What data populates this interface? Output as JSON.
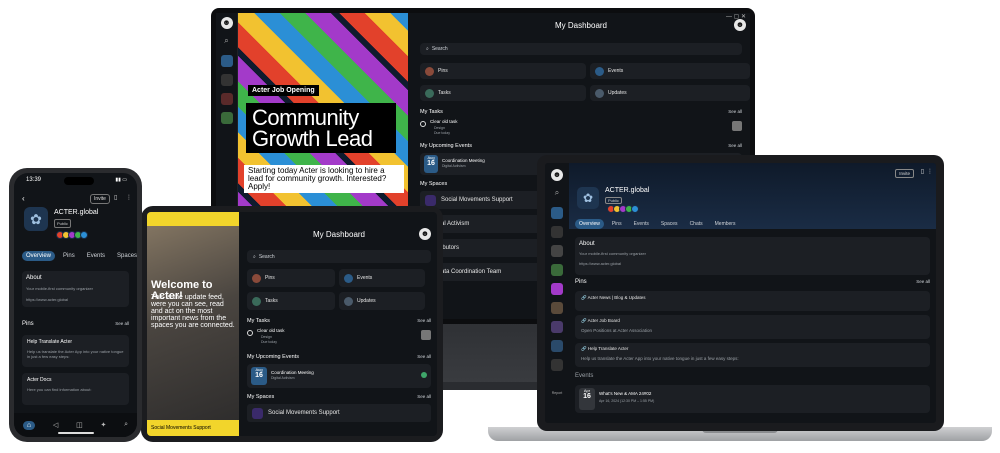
{
  "monitor": {
    "title": "My Dashboard",
    "poster": {
      "label": "Acter Job Opening",
      "title": "Community Growth Lead",
      "subtitle": "Starting today Acter is looking to hire a lead for community growth. Interested? Apply!"
    },
    "search_placeholder": "Search",
    "tiles": [
      "Pins",
      "Events",
      "Tasks",
      "Updates"
    ],
    "my_tasks": {
      "heading": "My Tasks",
      "see_all": "See all",
      "task": "Clear old task",
      "meta1": "Design",
      "meta2": "Due today"
    },
    "my_events": {
      "heading": "My Upcoming Events",
      "see_all": "See all",
      "month": "Aug",
      "day": "16",
      "title": "Coordination Meeting",
      "sub": "Digital Activism"
    },
    "my_spaces": {
      "heading": "My Spaces",
      "items": [
        "Social Movements Support",
        "al Activism",
        "ibutors",
        "ata Coordination Team"
      ]
    }
  },
  "tablet": {
    "title": "My Dashboard",
    "welcome": "Welcome to Acter!",
    "welcome_body": "This is the update feed, were you can see, read and act on the most important news from the spaces you are connected.",
    "footer": "Social Movements Support",
    "search_placeholder": "Search",
    "tiles": [
      "Pins",
      "Events",
      "Tasks",
      "Updates"
    ],
    "my_tasks": {
      "heading": "My Tasks",
      "see_all": "See all",
      "task": "Clear old task",
      "meta1": "Design",
      "meta2": "Due today"
    },
    "my_events": {
      "heading": "My Upcoming Events",
      "see_all": "See all",
      "month": "Aug",
      "day": "16",
      "title": "Coordination Meeting",
      "sub": "Digital Activism"
    },
    "my_spaces": {
      "heading": "My Spaces",
      "see_all": "See all",
      "item": "Social Movements Support"
    }
  },
  "phone": {
    "time": "13:39",
    "invite": "Invite",
    "space_name": "ACTER.global",
    "visibility": "Public",
    "tabs": [
      "Overview",
      "Pins",
      "Events",
      "Spaces"
    ],
    "about_title": "About",
    "about_text": "Your mobile-first community organizer",
    "about_url": "https://www.acter.global",
    "pins_heading": "Pins",
    "see_all": "See all",
    "pin1_title": "Help Translate Acter",
    "pin1_text": "Help us translate the Acter App into your native tongue in just a few easy steps:",
    "pin2_title": "Acter Docs",
    "pin2_text": "Here you can find information about:"
  },
  "laptop": {
    "invite": "Invite",
    "space_name": "ACTER.global",
    "visibility": "Public",
    "tabs": [
      "Overview",
      "Pins",
      "Events",
      "Spaces",
      "Chats",
      "Members"
    ],
    "about_title": "About",
    "about_text": "Your mobile-first community organizer",
    "about_url": "https://www.acter.global",
    "pins_heading": "Pins",
    "see_all": "See all",
    "pins": [
      "Acter News | Blog & Updates",
      "Acter Job Board",
      "Open Positions at Acter Association",
      "Help Translate Acter",
      "Help us translate the Acter App into your native tongue in just a few easy steps:"
    ],
    "events_heading": "Events",
    "event": {
      "month": "Apr",
      "day": "16",
      "title": "What's New & AMA 24#02",
      "time": "Apr 16, 2024 (12:30 PM – 1:55 PM)"
    },
    "rail_label": "Report"
  },
  "colors": {
    "accent": "#2b5b87",
    "bg": "#111418",
    "card": "#1c1f24"
  }
}
